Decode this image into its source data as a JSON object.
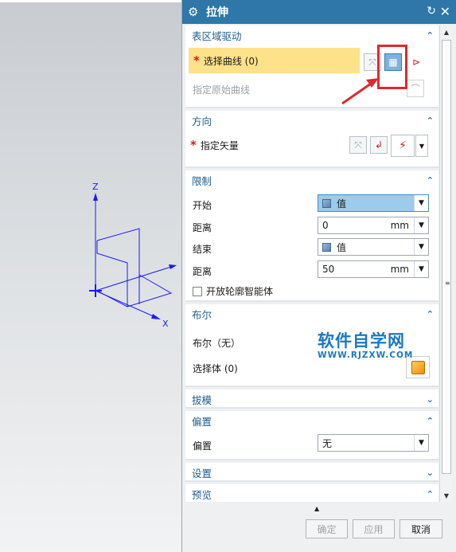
{
  "viewport": {
    "axis_labels": {
      "z": "Z",
      "x": "X"
    }
  },
  "dialog": {
    "title": "拉伸",
    "icons": {
      "title": "gear-icon",
      "reset": "reset-icon",
      "close": "close-icon"
    },
    "sections": {
      "table_drive": {
        "title": "表区域驱动",
        "select_curve": "选择曲线 (0)",
        "specify_original": "指定原始曲线"
      },
      "direction": {
        "title": "方向",
        "specify_vector": "指定矢量"
      },
      "limits": {
        "title": "限制",
        "start_label": "开始",
        "start_value": "值",
        "distance1_label": "距离",
        "distance1_value": "0",
        "unit": "mm",
        "end_label": "结束",
        "end_value": "值",
        "distance2_label": "距离",
        "distance2_value": "50",
        "open_profile": "开放轮廓智能体"
      },
      "boolean": {
        "title": "布尔",
        "boolean_label": "布尔（无）",
        "select_body": "选择体 (0)"
      },
      "draft": {
        "title": "拔模"
      },
      "offset": {
        "title": "偏置",
        "offset_label": "偏置",
        "offset_value": "无"
      },
      "settings": {
        "title": "设置"
      },
      "preview": {
        "title": "预览"
      }
    },
    "footer": {
      "ok": "确定",
      "apply": "应用",
      "cancel": "取消"
    }
  },
  "watermark": {
    "line1": "软件自学网",
    "line2": "WWW.RJZXW.COM"
  },
  "colors": {
    "title_bar": "#2e77a8",
    "highlight_row": "#fde28a",
    "section_title": "#1f5d8e",
    "axis": "#1a1aff",
    "annotation": "#e0282e"
  }
}
